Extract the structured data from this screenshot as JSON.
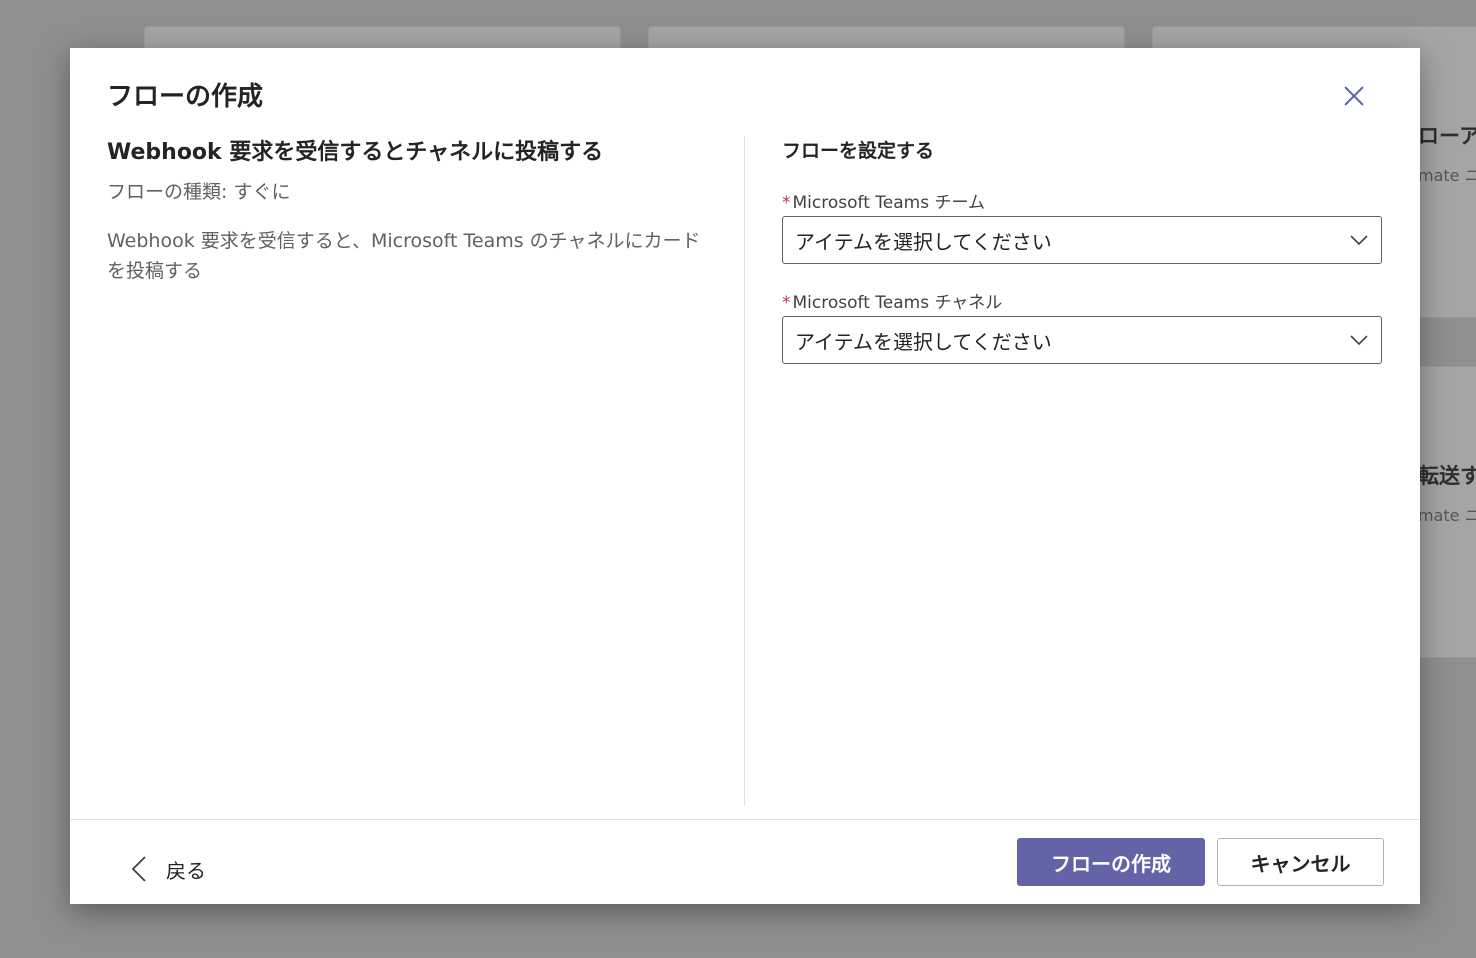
{
  "background": {
    "card1_title": "ローア",
    "card1_sub": "mate ニ",
    "card2_title": "転送す",
    "card2_sub": "mate ニ"
  },
  "dialog": {
    "title": "フローの作成",
    "close_icon": "close-icon"
  },
  "template": {
    "title": "Webhook 要求を受信するとチャネルに投稿する",
    "flow_type": "フローの種類: すぐに",
    "description": "Webhook 要求を受信すると、Microsoft Teams のチャネルにカードを投稿する"
  },
  "setup": {
    "section_title": "フローを設定する",
    "team_field": {
      "required_mark": "*",
      "label": "Microsoft Teams チーム",
      "value": "アイテムを選択してください"
    },
    "channel_field": {
      "required_mark": "*",
      "label": "Microsoft Teams チャネル",
      "value": "アイテムを選択してください"
    }
  },
  "footer": {
    "back_label": "戻る",
    "create_label": "フローの作成",
    "cancel_label": "キャンセル"
  },
  "colors": {
    "accent": "#6264a7",
    "required": "#c4314b",
    "overlay": "#8f8f8f"
  }
}
